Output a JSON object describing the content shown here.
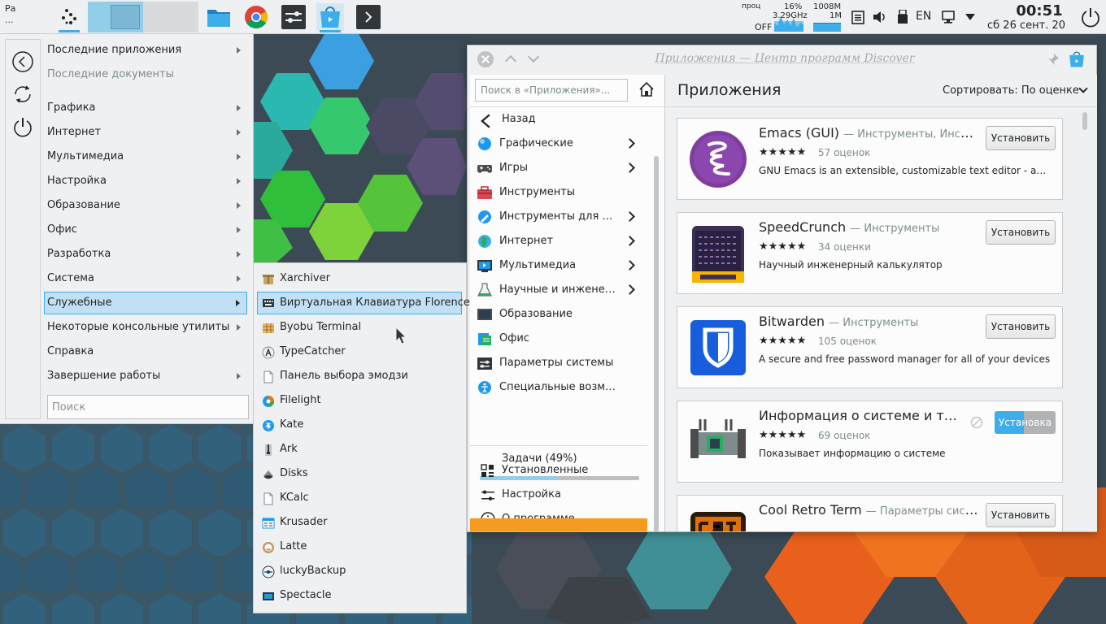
{
  "colors": {
    "accent": "#3daee9",
    "selection_bg": "#c2e0f5",
    "panel_bg": "#eff0f1",
    "orange": "#f39c1f"
  },
  "panel": {
    "workspace_label": "Ра\n...",
    "tasks": [
      {
        "name": "dolphin",
        "icon": "folder-icon"
      },
      {
        "name": "chrome",
        "icon": "chrome-icon"
      },
      {
        "name": "system-settings",
        "icon": "settings-sliders-icon"
      },
      {
        "name": "discover",
        "icon": "discover-icon",
        "active": true
      },
      {
        "name": "terminal",
        "icon": "terminal-icon"
      }
    ],
    "sysmon": {
      "cpu_label": "проц",
      "cpu_percent": "16%",
      "cpu_freq": "3.29GHz",
      "swap": "OFF",
      "mem_total": "1008M",
      "mem_used": "1M"
    },
    "tray": {
      "language": "EN"
    },
    "clock": {
      "time": "00:51",
      "date": "сб 26 сент. 20"
    }
  },
  "menu": {
    "items": [
      {
        "label": "Последние приложения",
        "arrow": true
      },
      {
        "label": "Последние документы",
        "dim": true
      },
      {
        "label": "Графика",
        "arrow": true
      },
      {
        "label": "Интернет",
        "arrow": true
      },
      {
        "label": "Мультимедиа",
        "arrow": true
      },
      {
        "label": "Настройка",
        "arrow": true
      },
      {
        "label": "Образование",
        "arrow": true
      },
      {
        "label": "Офис",
        "arrow": true
      },
      {
        "label": "Разработка",
        "arrow": true
      },
      {
        "label": "Система",
        "arrow": true
      },
      {
        "label": "Служебные",
        "arrow": true,
        "selected": true
      },
      {
        "label": "Некоторые консольные утилиты",
        "arrow": true
      },
      {
        "label": "Справка"
      },
      {
        "label": "Завершение работы",
        "arrow": true
      }
    ],
    "search_placeholder": "Поиск"
  },
  "submenu": {
    "items": [
      {
        "label": "Xarchiver",
        "icon": "archive-icon"
      },
      {
        "label": "Виртуальная Клавиатура Florence",
        "icon": "keyboard-icon",
        "selected": true
      },
      {
        "label": "Byobu Terminal",
        "icon": "byobu-icon"
      },
      {
        "label": "TypeCatcher",
        "icon": "font-icon"
      },
      {
        "label": "Панель выбора эмодзи",
        "icon": "document-icon"
      },
      {
        "label": "Filelight",
        "icon": "filelight-icon"
      },
      {
        "label": "Kate",
        "icon": "kate-icon"
      },
      {
        "label": "Ark",
        "icon": "ark-icon"
      },
      {
        "label": "Disks",
        "icon": "disks-icon"
      },
      {
        "label": "KCalc",
        "icon": "document-icon"
      },
      {
        "label": "Krusader",
        "icon": "krusader-icon"
      },
      {
        "label": "Latte",
        "icon": "latte-icon"
      },
      {
        "label": "luckyBackup",
        "icon": "backup-icon"
      },
      {
        "label": "Spectacle",
        "icon": "spectacle-icon"
      }
    ]
  },
  "discover": {
    "window_title": "Приложения — Центр программ Discover",
    "search_placeholder": "Поиск в «Приложения»...",
    "back_label": "Назад",
    "categories": [
      {
        "label": "Графические",
        "icon": "graphics-icon",
        "arrow": true
      },
      {
        "label": "Игры",
        "icon": "gamepad-icon",
        "arrow": true
      },
      {
        "label": "Инструменты",
        "icon": "toolbox-icon"
      },
      {
        "label": "Инструменты для разработки",
        "icon": "devtools-icon",
        "arrow": true
      },
      {
        "label": "Интернет",
        "icon": "globe-icon",
        "arrow": true
      },
      {
        "label": "Мультимедиа",
        "icon": "multimedia-icon",
        "arrow": true
      },
      {
        "label": "Научные и инженерные",
        "icon": "flask-icon",
        "arrow": true
      },
      {
        "label": "Образование",
        "icon": "education-icon"
      },
      {
        "label": "Офис",
        "icon": "office-icon"
      },
      {
        "label": "Параметры системы",
        "icon": "system-settings-icon"
      },
      {
        "label": "Специальные возможности",
        "icon": "accessibility-icon"
      }
    ],
    "tasks_label": "Задачи (49%)",
    "tasks_progress": 0.49,
    "bottom_items": [
      {
        "label": "Установленные",
        "icon": "installed-icon"
      },
      {
        "label": "Настройка",
        "icon": "sliders-icon"
      },
      {
        "label": "О программе",
        "icon": "info-icon"
      }
    ],
    "page_title": "Приложения",
    "sort_label": "Сортировать: По оценке",
    "apps": [
      {
        "name": "Emacs (GUI)",
        "category": "— Инструменты, Инструме...",
        "stars": "★★★★★",
        "ratings": "57 оценок",
        "desc": "GNU Emacs is an extensible, customizable text editor - and ...",
        "button": "Установить",
        "icon": "emacs-icon"
      },
      {
        "name": "SpeedCrunch",
        "category": "— Инструменты",
        "stars": "★★★★★",
        "ratings": "34 оценки",
        "desc": "Научный инженерный калькулятор",
        "button": "Установить",
        "icon": "speedcrunch-icon"
      },
      {
        "name": "Bitwarden",
        "category": "— Инструменты",
        "stars": "★★★★★",
        "ratings": "105 оценок",
        "desc": "A secure and free password manager for all of your devices",
        "button": "Установить",
        "icon": "bitwarden-icon"
      },
      {
        "name": "Информация о системе и тес...",
        "category": "",
        "stars": "★★★★★",
        "ratings": "69 оценок",
        "desc": "Показывает информацию о системе",
        "button": "Установка",
        "progress": 0.48,
        "icon": "sysinfo-icon"
      },
      {
        "name": "Cool Retro Term",
        "category": "— Параметры системы",
        "stars": "",
        "ratings": "",
        "desc": "",
        "button": "Установить",
        "icon": "cool-retro-term-icon"
      }
    ]
  }
}
